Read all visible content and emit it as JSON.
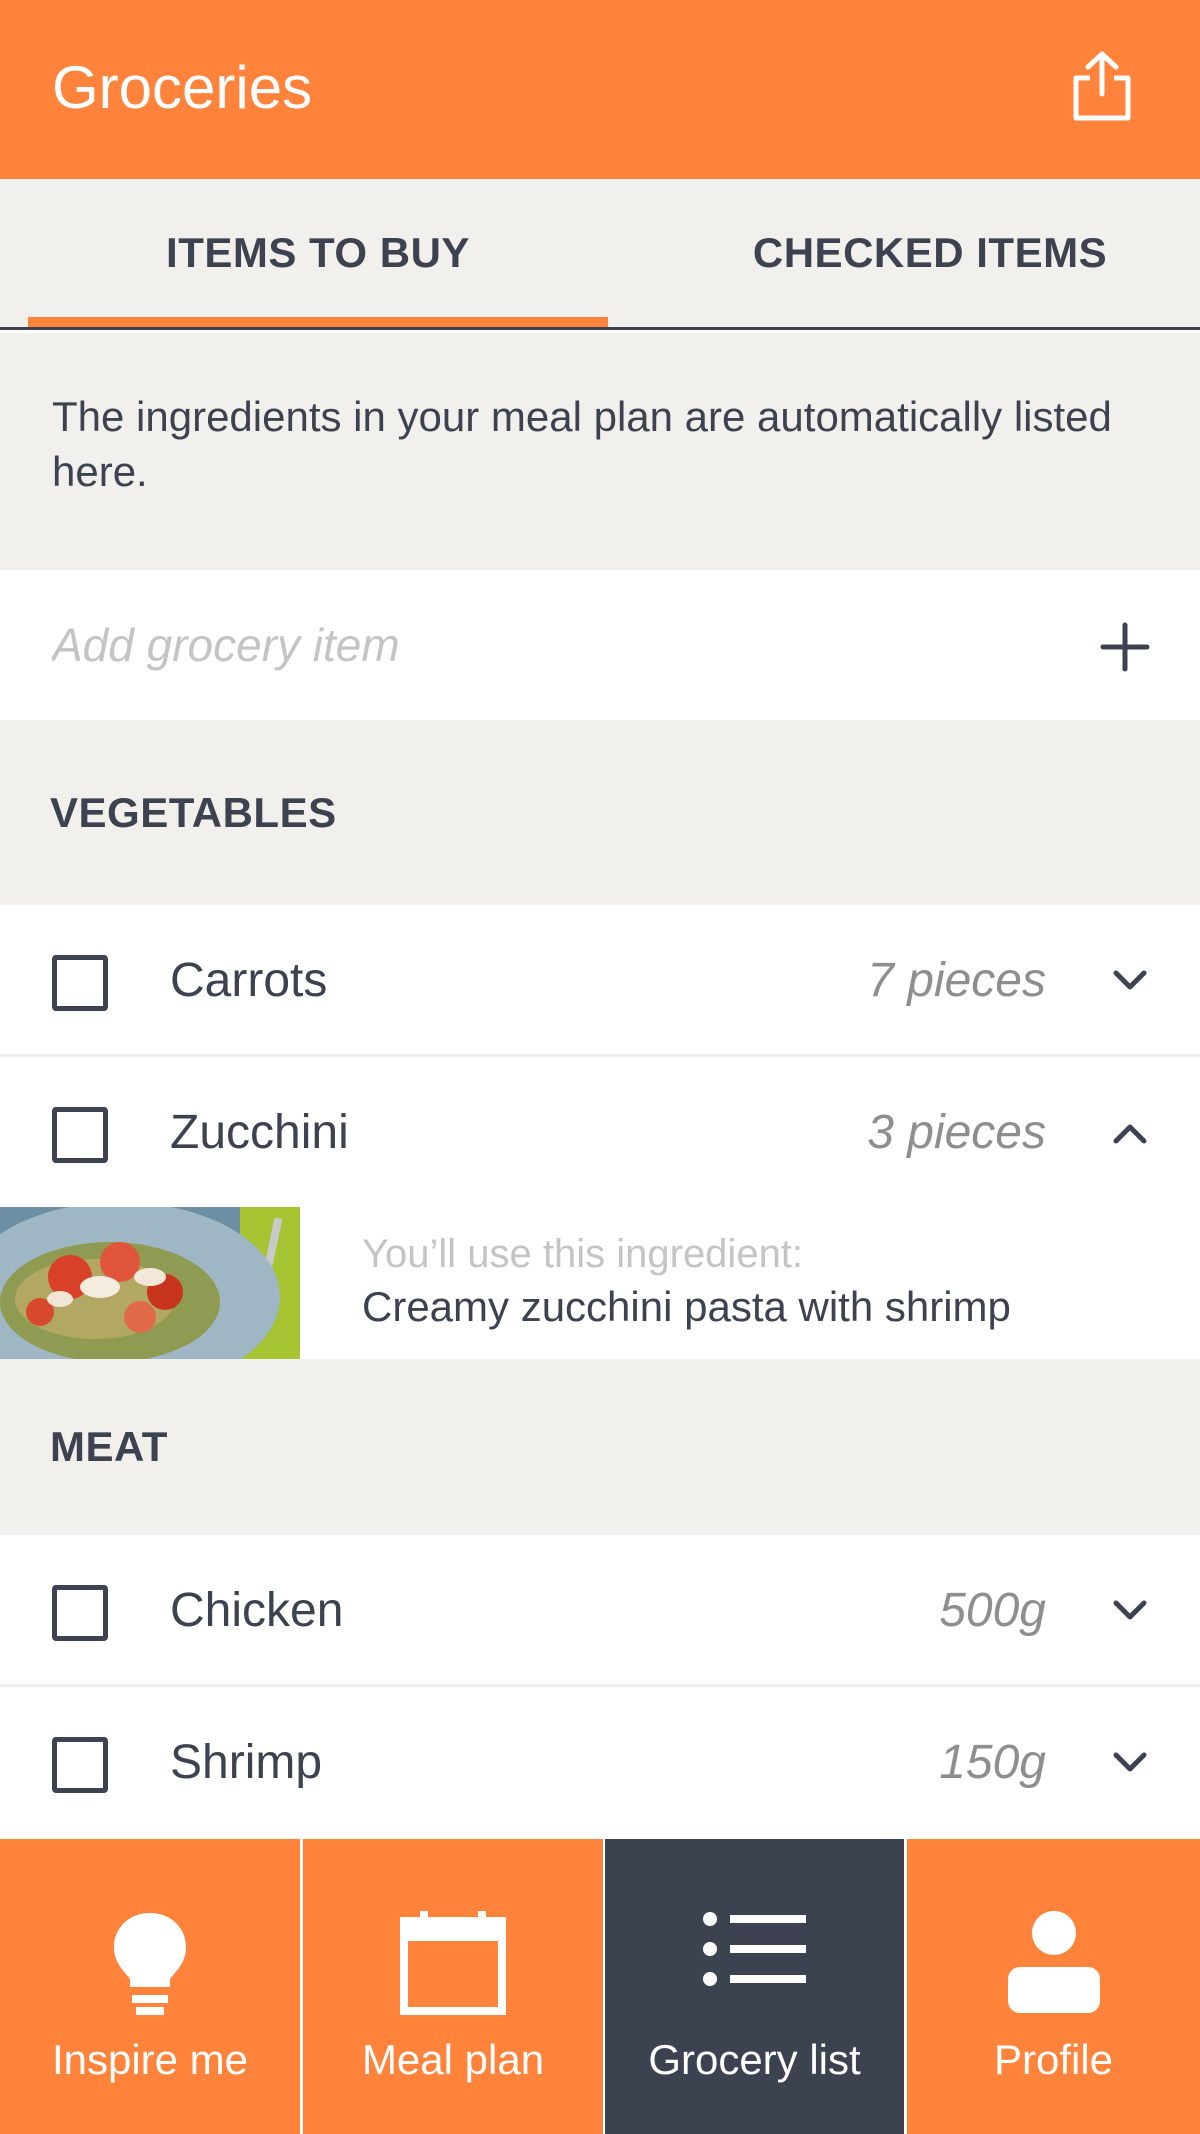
{
  "header": {
    "title": "Groceries",
    "share_icon": "share-icon"
  },
  "tabs": [
    {
      "label": "ITEMS TO BUY",
      "active": true
    },
    {
      "label": "CHECKED ITEMS",
      "active": false
    }
  ],
  "info_text": "The ingredients in your meal plan are automatically listed here.",
  "add_item": {
    "placeholder": "Add grocery item",
    "icon": "plus-icon"
  },
  "sections": [
    {
      "title": "VEGETABLES",
      "items": [
        {
          "name": "Carrots",
          "quantity": "7 pieces",
          "expanded": false
        },
        {
          "name": "Zucchini",
          "quantity": "3 pieces",
          "expanded": true,
          "usage_hint": "You’ll use this ingredient:",
          "usage_recipe": "Creamy zucchini pasta with shrimp"
        }
      ]
    },
    {
      "title": "MEAT",
      "items": [
        {
          "name": "Chicken",
          "quantity": "500g",
          "expanded": false
        },
        {
          "name": "Shrimp",
          "quantity": "150g",
          "expanded": false
        }
      ]
    }
  ],
  "nav": [
    {
      "label": "Inspire me",
      "icon": "lightbulb-icon",
      "active": false
    },
    {
      "label": "Meal plan",
      "icon": "calendar-icon",
      "active": false
    },
    {
      "label": "Grocery list",
      "icon": "list-icon",
      "active": true
    },
    {
      "label": "Profile",
      "icon": "person-icon",
      "active": false
    }
  ],
  "colors": {
    "accent": "#ff833b",
    "dark": "#3d4250",
    "panel": "#f2f0ec"
  }
}
